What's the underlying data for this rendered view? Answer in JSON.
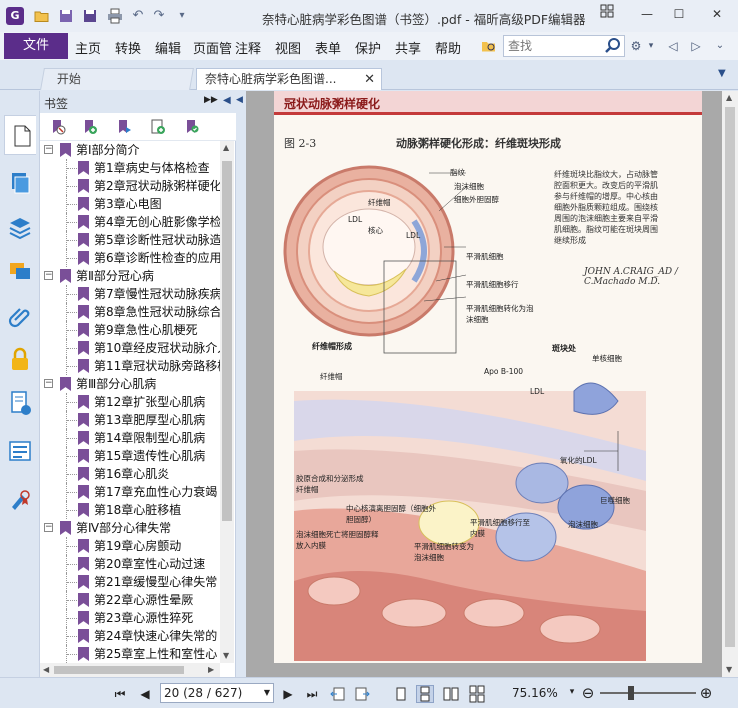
{
  "window": {
    "title": "奈特心脏病学彩色图谱（书签）.pdf - 福昕高级PDF编辑器",
    "logo_letter": "G",
    "controls": {
      "minimize": "—",
      "maximize": "☐",
      "close": "✕"
    }
  },
  "ribbon": {
    "file_label": "文件",
    "menus": [
      "主页",
      "转换",
      "编辑",
      "页面管",
      "注释",
      "视图",
      "表单",
      "保护",
      "共享",
      "帮助"
    ],
    "search_placeholder": "查找"
  },
  "tabs": {
    "start_label": "开始",
    "doc_label": "奈特心脏病学彩色图谱..."
  },
  "bookmarks": {
    "panel_title": "书签",
    "items": [
      {
        "level": 0,
        "label": "第Ⅰ部分简介",
        "expander": "−"
      },
      {
        "level": 1,
        "label": "第1章病史与体格检查"
      },
      {
        "level": 1,
        "label": "第2章冠状动脉粥样硬化"
      },
      {
        "level": 1,
        "label": "第3章心电图"
      },
      {
        "level": 1,
        "label": "第4章无创心脏影像学检查"
      },
      {
        "level": 1,
        "label": "第5章诊断性冠状动脉造影"
      },
      {
        "level": 1,
        "label": "第6章诊断性检查的应用"
      },
      {
        "level": 0,
        "label": "第Ⅱ部分冠心病",
        "expander": "−"
      },
      {
        "level": 1,
        "label": "第7章慢性冠状动脉疾病"
      },
      {
        "level": 1,
        "label": "第8章急性冠状动脉综合征"
      },
      {
        "level": 1,
        "label": "第9章急性心肌梗死"
      },
      {
        "level": 1,
        "label": "第10章经皮冠状动脉介入"
      },
      {
        "level": 1,
        "label": "第11章冠状动脉旁路移植"
      },
      {
        "level": 0,
        "label": "第Ⅲ部分心肌病",
        "expander": "−"
      },
      {
        "level": 1,
        "label": "第12章扩张型心肌病"
      },
      {
        "level": 1,
        "label": "第13章肥厚型心肌病"
      },
      {
        "level": 1,
        "label": "第14章限制型心肌病"
      },
      {
        "level": 1,
        "label": "第15章遗传性心肌病"
      },
      {
        "level": 1,
        "label": "第16章心肌炎"
      },
      {
        "level": 1,
        "label": "第17章充血性心力衰竭"
      },
      {
        "level": 1,
        "label": "第18章心脏移植"
      },
      {
        "level": 0,
        "label": "第Ⅳ部分心律失常",
        "expander": "−"
      },
      {
        "level": 1,
        "label": "第19章心房颤动"
      },
      {
        "level": 1,
        "label": "第20章室性心动过速"
      },
      {
        "level": 1,
        "label": "第21章缓慢型心律失常"
      },
      {
        "level": 1,
        "label": "第22章心源性晕厥"
      },
      {
        "level": 1,
        "label": "第23章心源性猝死"
      },
      {
        "level": 1,
        "label": "第24章快速心律失常的"
      },
      {
        "level": 1,
        "label": "第25章室上性和室性心"
      }
    ]
  },
  "page": {
    "header": "冠状动脉粥样硬化",
    "figure_label": "图 2-3",
    "figure_title": "动脉粥样硬化形成：纤维斑块形成",
    "caption": "纤维斑块比脂纹大，占动脉管腔面积更大。改变后的平滑肌参与纤维帽的增厚。中心核由细胞外脂质颗粒组成。围绕核周围的泡沫细胞主要来自平滑肌细胞。脂纹可能在斑块周围继续形成",
    "signature": "JOHN A.CRAIG_AD / C.Machado M.D.",
    "labels": {
      "top": [
        "脂纹",
        "泡沫细胞",
        "细胞外胆固醇",
        "纤维帽",
        "LDL",
        "核心",
        "LDL",
        "平滑肌细胞",
        "平滑肌细胞移行",
        "平滑肌细胞转化为泡沫细胞"
      ],
      "bottom": [
        "纤维帽形成",
        "斑块处",
        "纤维帽",
        "Apo B-100",
        "单核细胞",
        "LDL",
        "氧化的LDL",
        "巨噬细胞",
        "泡沫细胞",
        "胶原合成和分泌形成纤维帽",
        "中心核演离胆固醇（细胞外胆固醇）",
        "泡沫细胞死亡将胆固醇释放入内膜",
        "平滑肌细胞转变为泡沫细胞",
        "平滑肌细胞移行至内膜"
      ]
    }
  },
  "status": {
    "page_display": "20 (28 / 627)",
    "zoom": "75.16%"
  },
  "colors": {
    "brand": "#5b2d8a",
    "ribbon_bg": "#eef2f8",
    "bookmark_flag": "#7a4f98",
    "page_header_rule": "#c43a3a"
  }
}
